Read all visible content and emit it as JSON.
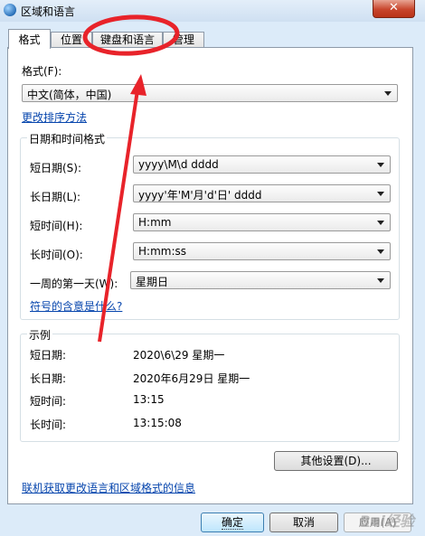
{
  "window": {
    "title": "区域和语言",
    "close_glyph": "✕"
  },
  "tabs": [
    {
      "label": "格式",
      "active": true
    },
    {
      "label": "位置",
      "active": false
    },
    {
      "label": "键盘和语言",
      "active": false
    },
    {
      "label": "管理",
      "active": false
    }
  ],
  "format": {
    "label": "格式(F):",
    "value": "中文(简体，中国)",
    "sort_link": "更改排序方法"
  },
  "datetime_group": {
    "title": "日期和时间格式",
    "rows": [
      {
        "label": "短日期(S):",
        "value": "yyyy\\M\\d dddd"
      },
      {
        "label": "长日期(L):",
        "value": "yyyy'年'M'月'd'日' dddd"
      },
      {
        "label": "短时间(H):",
        "value": "H:mm"
      },
      {
        "label": "长时间(O):",
        "value": "H:mm:ss"
      },
      {
        "label": "一周的第一天(W):",
        "value": "星期日"
      }
    ],
    "symbols_link": "符号的含意是什么?"
  },
  "examples": {
    "title": "示例",
    "rows": [
      {
        "label": "短日期:",
        "value": "2020\\6\\29 星期一"
      },
      {
        "label": "长日期:",
        "value": "2020年6月29日 星期一"
      },
      {
        "label": "短时间:",
        "value": "13:15"
      },
      {
        "label": "长时间:",
        "value": "13:15:08"
      }
    ]
  },
  "other_settings_button": "其他设置(D)...",
  "online_link": "联机获取更改语言和区域格式的信息",
  "buttons": {
    "ok": "确定",
    "cancel": "取消",
    "apply": "应用(A)"
  },
  "watermark": "Bai经验",
  "annotation_color": "#e8232a"
}
